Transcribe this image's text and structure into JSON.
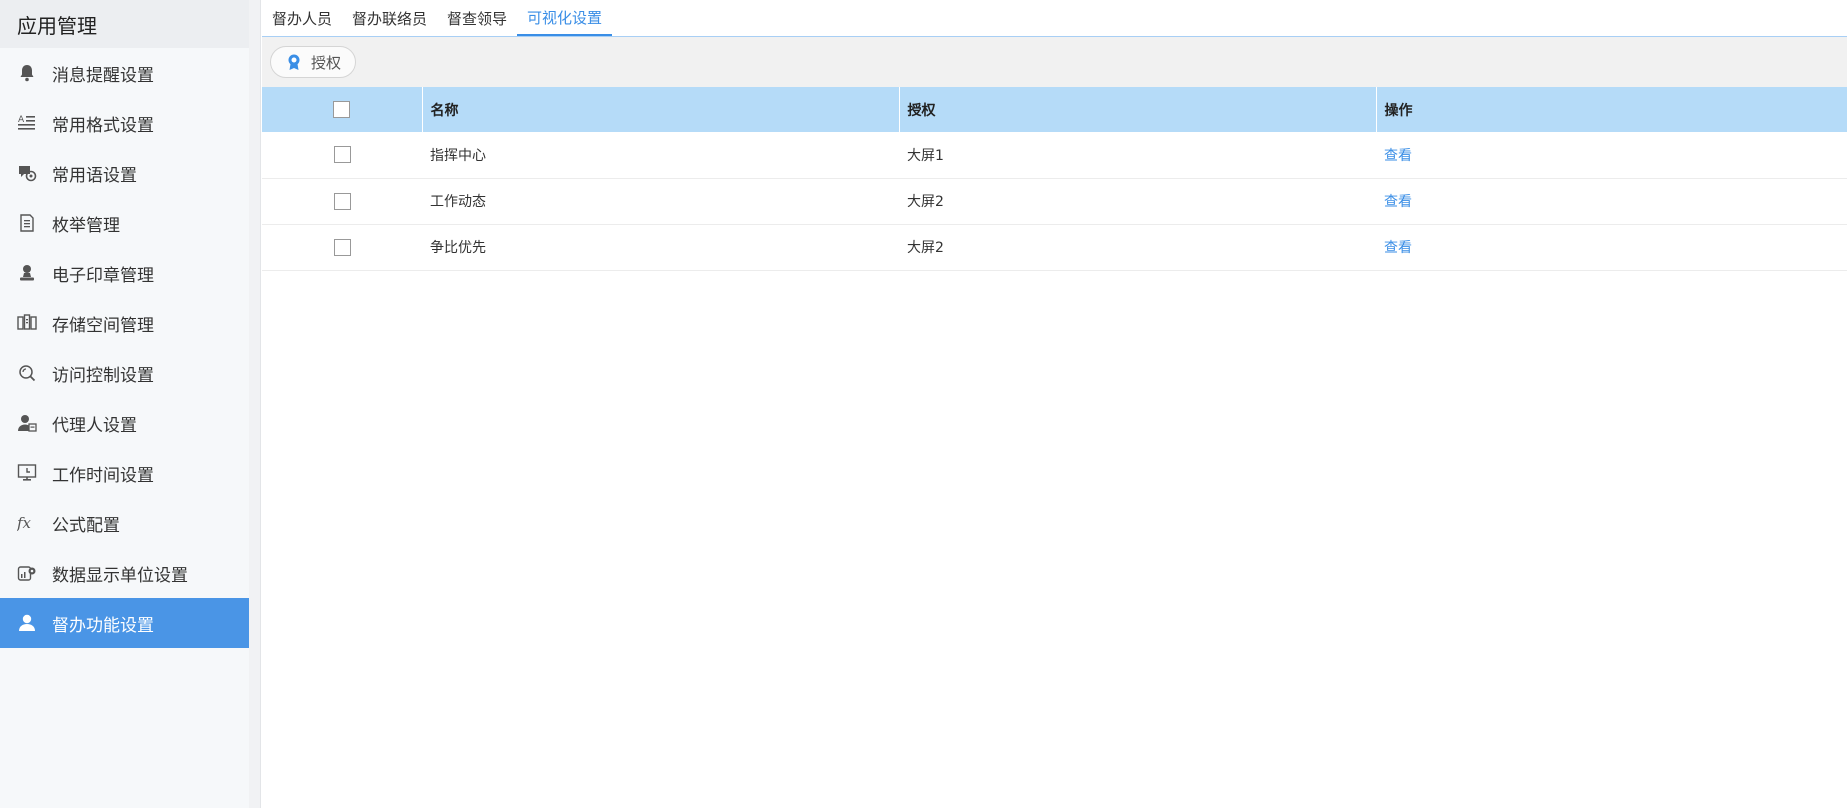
{
  "sidebar": {
    "title": "应用管理",
    "items": [
      {
        "label": "消息提醒设置",
        "icon": "bell-icon"
      },
      {
        "label": "常用格式设置",
        "icon": "format-text-icon"
      },
      {
        "label": "常用语设置",
        "icon": "chat-bubble-icon"
      },
      {
        "label": "枚举管理",
        "icon": "document-list-icon"
      },
      {
        "label": "电子印章管理",
        "icon": "stamp-icon"
      },
      {
        "label": "存储空间管理",
        "icon": "storage-icon"
      },
      {
        "label": "访问控制设置",
        "icon": "access-search-icon"
      },
      {
        "label": "代理人设置",
        "icon": "agent-person-icon"
      },
      {
        "label": "工作时间设置",
        "icon": "monitor-clock-icon"
      },
      {
        "label": "公式配置",
        "icon": "formula-fx-icon"
      },
      {
        "label": "数据显示单位设置",
        "icon": "data-unit-gear-icon"
      },
      {
        "label": "督办功能设置",
        "icon": "supervise-person-icon",
        "active": true
      }
    ]
  },
  "tabs": [
    {
      "label": "督办人员"
    },
    {
      "label": "督办联络员"
    },
    {
      "label": "督查领导"
    },
    {
      "label": "可视化设置",
      "active": true
    }
  ],
  "toolbar": {
    "authorize_label": "授权",
    "authorize_icon": "award-badge-icon"
  },
  "table": {
    "columns": [
      "",
      "名称",
      "授权",
      "操作"
    ],
    "rows": [
      {
        "name": "指挥中心",
        "auth": "大屏1",
        "action": "查看"
      },
      {
        "name": "工作动态",
        "auth": "大屏2",
        "action": "查看"
      },
      {
        "name": "争比优先",
        "auth": "大屏2",
        "action": "查看"
      }
    ]
  },
  "colors": {
    "accent": "#3a8ee6",
    "active_nav_bg": "#4a95e6",
    "table_header_bg": "#b5dbf8"
  }
}
